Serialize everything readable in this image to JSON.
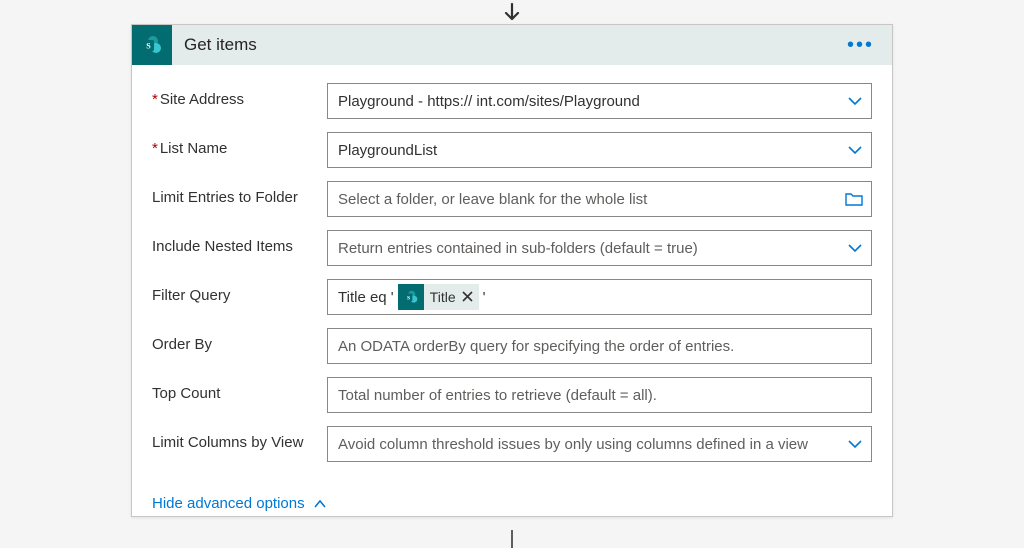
{
  "connector_arrow": "down",
  "header": {
    "title": "Get items",
    "icon_name": "sharepoint-icon"
  },
  "fields": {
    "site_address": {
      "label": "Site Address",
      "required": true,
      "value": "Playground - https://                                  int.com/sites/Playground",
      "has_dropdown": true
    },
    "list_name": {
      "label": "List Name",
      "required": true,
      "value": "PlaygroundList",
      "has_dropdown": true
    },
    "limit_folder": {
      "label": "Limit Entries to Folder",
      "required": false,
      "placeholder": "Select a folder, or leave blank for the whole list",
      "has_folder_picker": true
    },
    "include_nested": {
      "label": "Include Nested Items",
      "required": false,
      "placeholder": "Return entries contained in sub-folders (default = true)",
      "has_dropdown": true
    },
    "filter_query": {
      "label": "Filter Query",
      "required": false,
      "prefix_text": "Title eq '",
      "suffix_text": "'",
      "token": {
        "label": "Title",
        "icon_name": "sharepoint-icon"
      }
    },
    "order_by": {
      "label": "Order By",
      "required": false,
      "placeholder": "An ODATA orderBy query for specifying the order of entries."
    },
    "top_count": {
      "label": "Top Count",
      "required": false,
      "placeholder": "Total number of entries to retrieve (default = all)."
    },
    "limit_columns": {
      "label": "Limit Columns by View",
      "required": false,
      "placeholder": "Avoid column threshold issues by only using columns defined in a view",
      "has_dropdown": true
    }
  },
  "advanced_toggle": {
    "label": "Hide advanced options"
  }
}
